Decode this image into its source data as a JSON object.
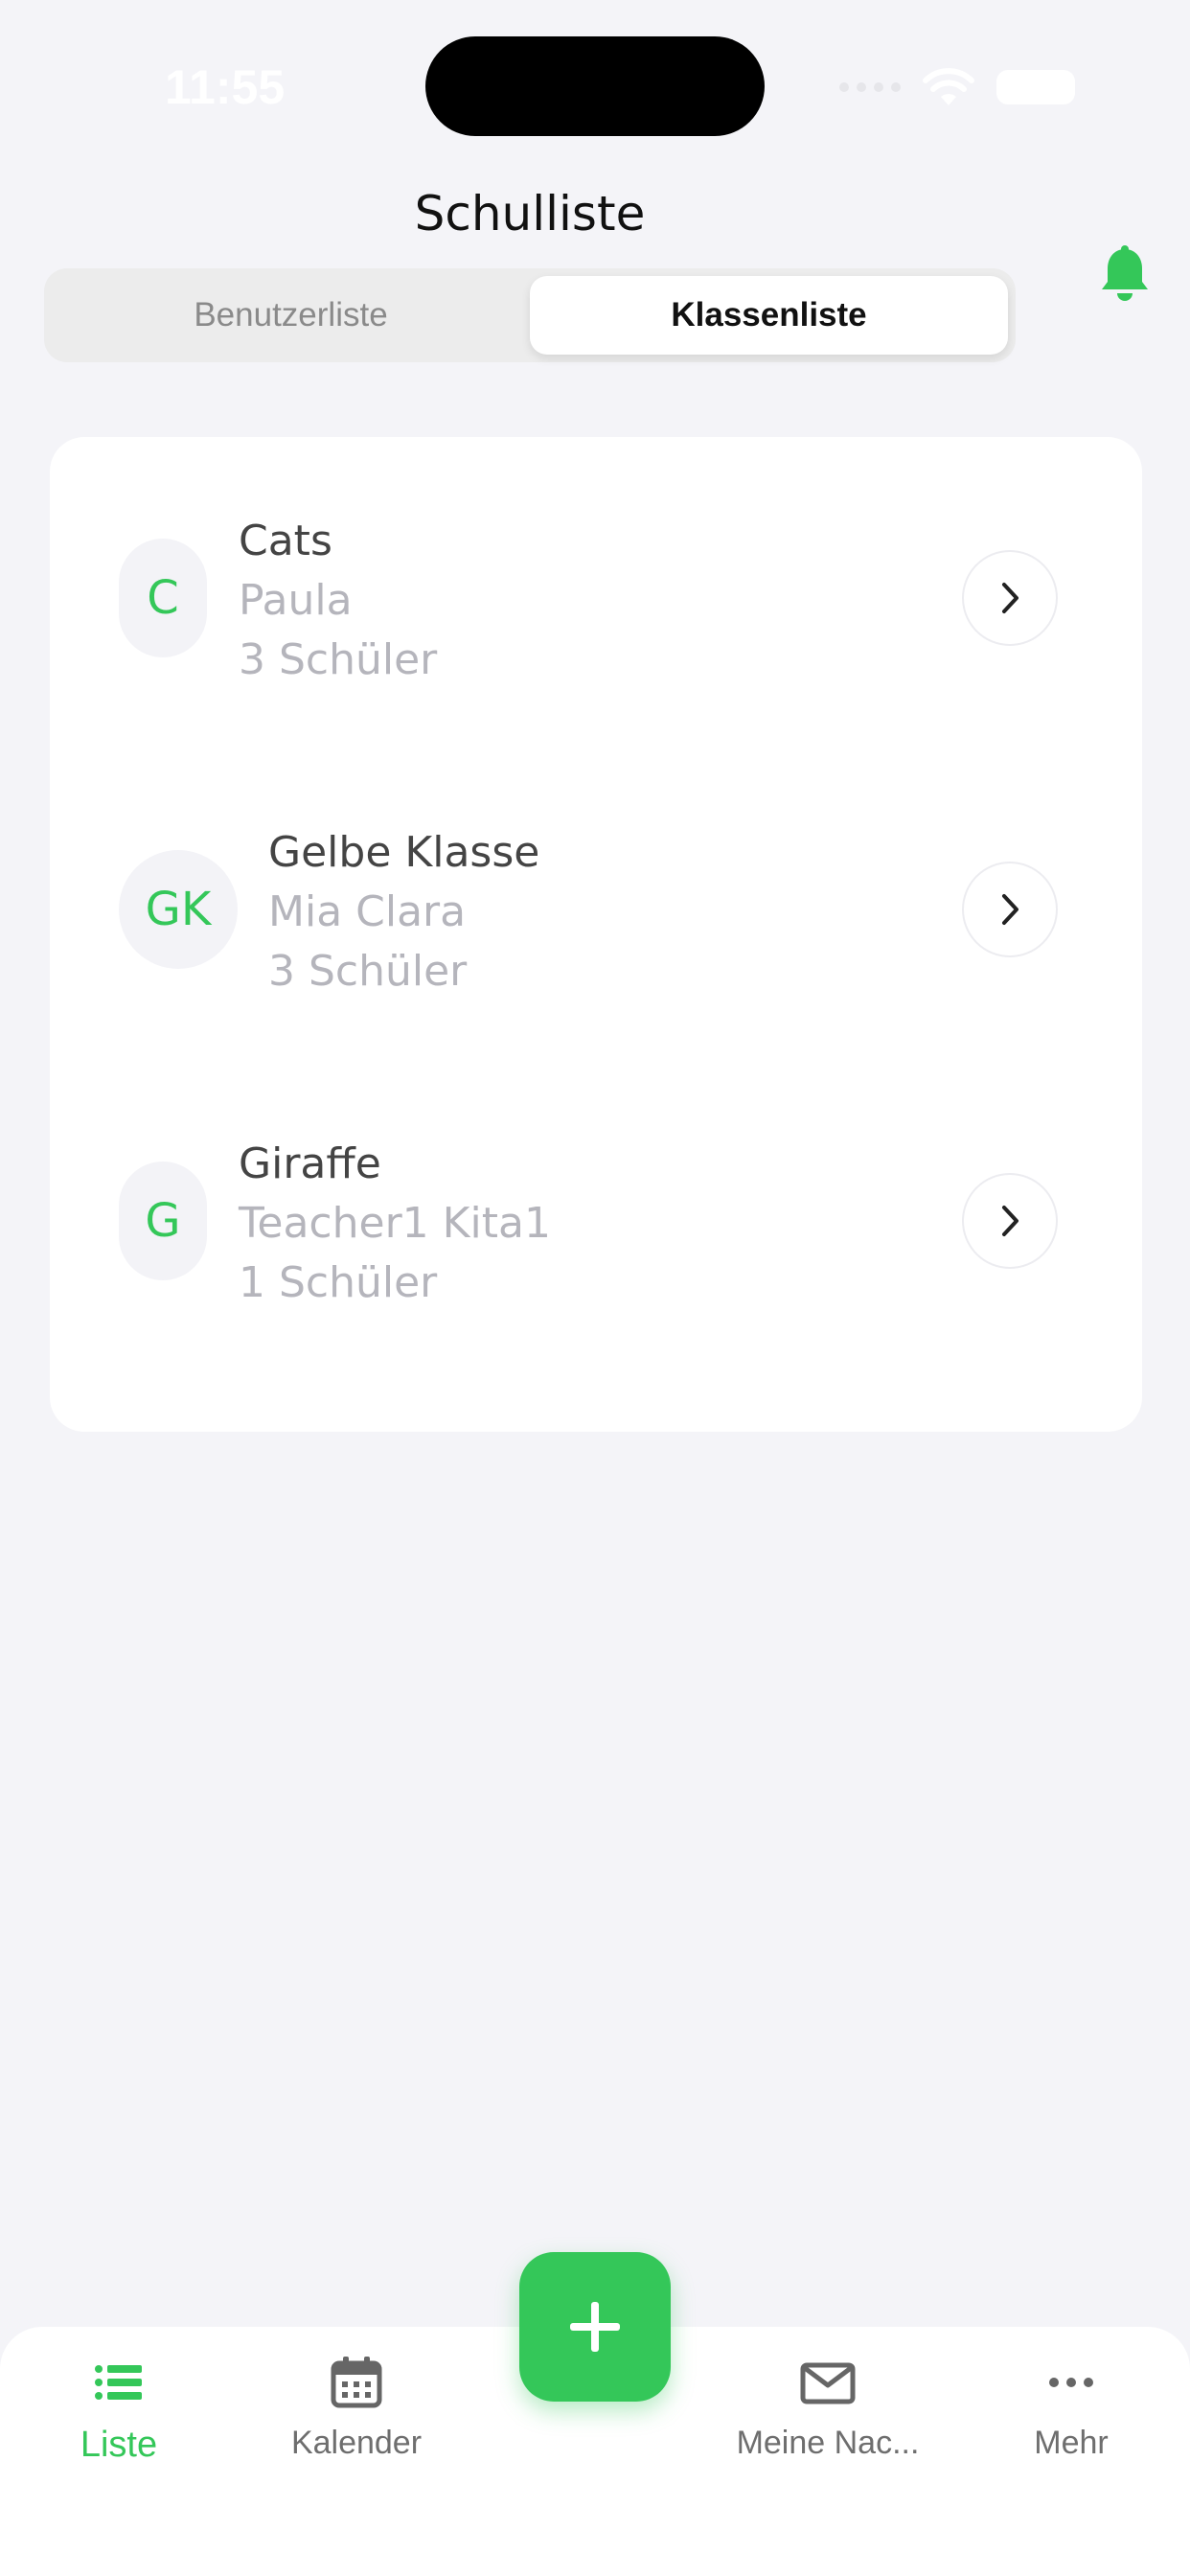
{
  "status": {
    "time": "11:55"
  },
  "header": {
    "title": "Schulliste"
  },
  "tabs": [
    {
      "label": "Benutzerliste",
      "active": false
    },
    {
      "label": "Klassenliste",
      "active": true
    }
  ],
  "classes": [
    {
      "initials": "C",
      "name": "Cats",
      "teacher": "Paula",
      "students": "3 Schüler"
    },
    {
      "initials": "GK",
      "name": "Gelbe Klasse",
      "teacher": "Mia Clara",
      "students": "3 Schüler"
    },
    {
      "initials": "G",
      "name": "Giraffe",
      "teacher": "Teacher1 Kita1",
      "students": "1 Schüler"
    }
  ],
  "nav": {
    "items": [
      {
        "label": "Liste",
        "icon": "list-icon",
        "active": true
      },
      {
        "label": "Kalender",
        "icon": "calendar-icon",
        "active": false
      },
      {
        "label": "Meine Nac...",
        "icon": "mail-icon",
        "active": false
      },
      {
        "label": "Mehr",
        "icon": "more-icon",
        "active": false
      }
    ],
    "fab_icon": "plus-icon"
  },
  "colors": {
    "accent": "#34c759",
    "background": "#f4f4f8",
    "card": "#ffffff"
  }
}
